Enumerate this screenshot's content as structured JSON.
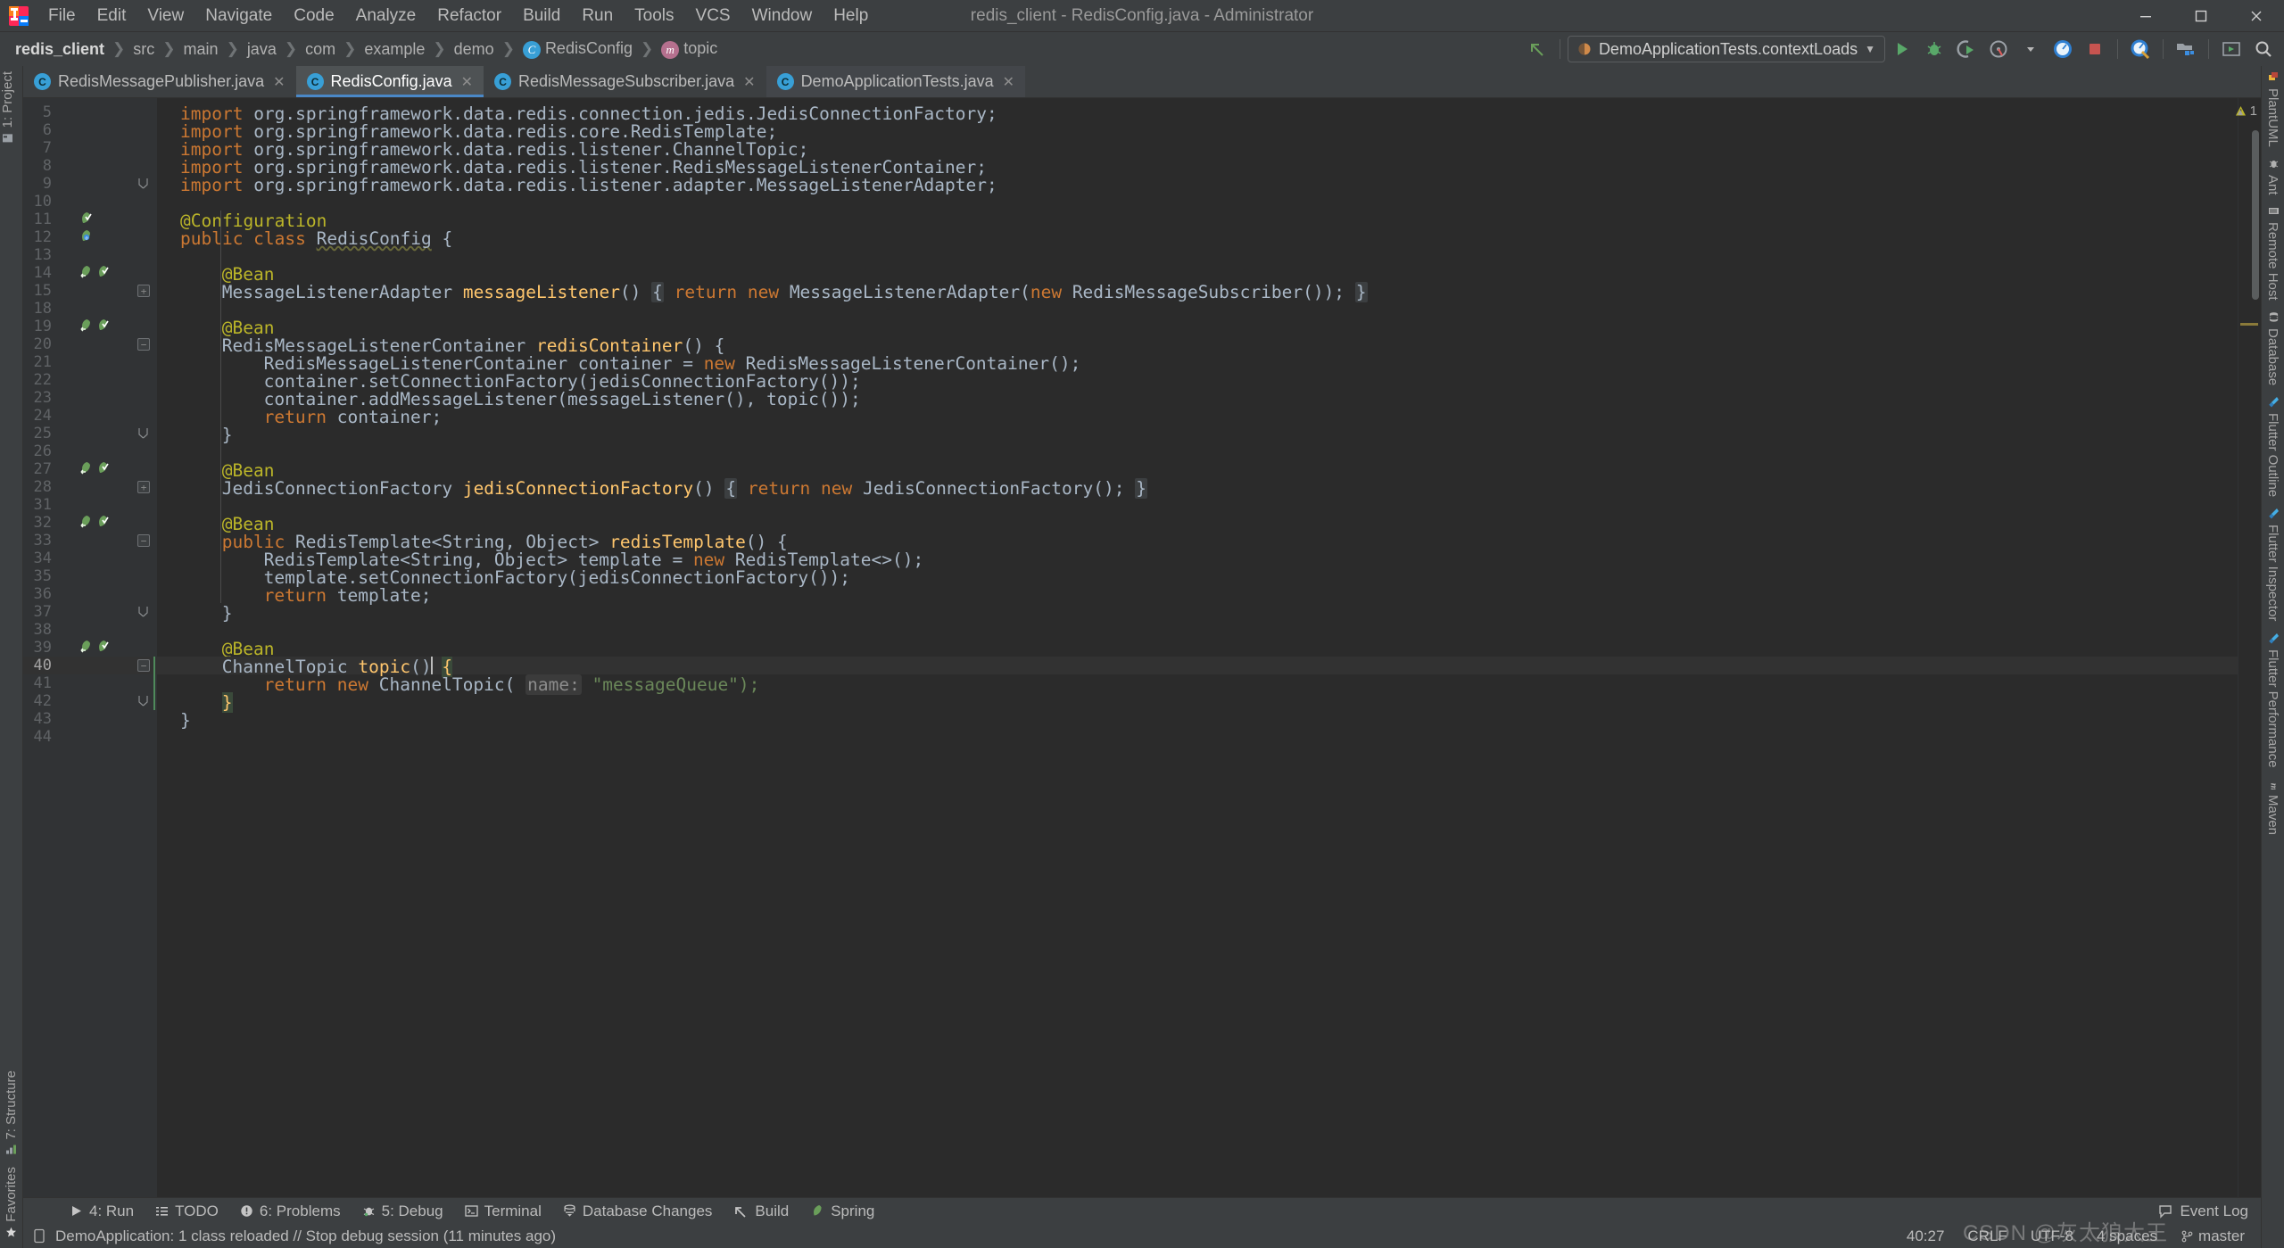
{
  "window": {
    "title": "redis_client - RedisConfig.java - Administrator",
    "minimize": "—",
    "maximize": "☐",
    "close": "✕"
  },
  "menu": {
    "items": [
      "File",
      "Edit",
      "View",
      "Navigate",
      "Code",
      "Analyze",
      "Refactor",
      "Build",
      "Run",
      "Tools",
      "VCS",
      "Window",
      "Help"
    ]
  },
  "breadcrumbs": [
    {
      "label": "redis_client",
      "bold": true,
      "icon": null
    },
    {
      "label": "src",
      "bold": false,
      "icon": null
    },
    {
      "label": "main",
      "bold": false,
      "icon": null
    },
    {
      "label": "java",
      "bold": false,
      "icon": null
    },
    {
      "label": "com",
      "bold": false,
      "icon": null
    },
    {
      "label": "example",
      "bold": false,
      "icon": null
    },
    {
      "label": "demo",
      "bold": false,
      "icon": null
    },
    {
      "label": "RedisConfig",
      "bold": false,
      "icon": "C",
      "iconColor": "#389fd6"
    },
    {
      "label": "topic",
      "bold": false,
      "icon": "m",
      "iconColor": "#b5708e"
    }
  ],
  "toolbar": {
    "run_config": "DemoApplicationTests.contextLoads",
    "dropdown_arrow": "▼",
    "icons": [
      "back-arrow-icon",
      "run-icon",
      "debug-icon",
      "run-coverage-icon",
      "profiler-icon",
      "stop-icon",
      "attach-profiler-icon",
      "project-structure-icon",
      "update-running-app-icon",
      "search-everywhere-icon"
    ]
  },
  "tabs": [
    {
      "label": "RedisMessagePublisher.java",
      "active": false,
      "dim": false,
      "icon": "C",
      "iconColor": "#389fd6"
    },
    {
      "label": "RedisConfig.java",
      "active": true,
      "dim": false,
      "icon": "C",
      "iconColor": "#389fd6"
    },
    {
      "label": "RedisMessageSubscriber.java",
      "active": false,
      "dim": false,
      "icon": "C",
      "iconColor": "#389fd6"
    },
    {
      "label": "DemoApplicationTests.java",
      "active": false,
      "dim": true,
      "icon": "C",
      "iconColor": "#389fd6"
    }
  ],
  "editor": {
    "first_line": 5,
    "inspection_count": "1",
    "inspection_icon": "warning-triangle-icon",
    "lines": [
      {
        "n": 5,
        "indent": 0,
        "tokens": [
          {
            "t": "import ",
            "c": "kw"
          },
          {
            "t": "org.springframework.data.redis.connection.jedis.JedisConnectionFactory;",
            "c": "cls"
          }
        ]
      },
      {
        "n": 6,
        "indent": 0,
        "tokens": [
          {
            "t": "import ",
            "c": "kw"
          },
          {
            "t": "org.springframework.data.redis.core.RedisTemplate;",
            "c": "cls"
          }
        ]
      },
      {
        "n": 7,
        "indent": 0,
        "tokens": [
          {
            "t": "import ",
            "c": "kw"
          },
          {
            "t": "org.springframework.data.redis.listener.ChannelTopic;",
            "c": "cls"
          }
        ]
      },
      {
        "n": 8,
        "indent": 0,
        "tokens": [
          {
            "t": "import ",
            "c": "kw"
          },
          {
            "t": "org.springframework.data.redis.listener.RedisMessageListenerContainer;",
            "c": "cls"
          }
        ]
      },
      {
        "n": 9,
        "indent": 0,
        "tokens": [
          {
            "t": "import ",
            "c": "kw"
          },
          {
            "t": "org.springframework.data.redis.listener.adapter.MessageListenerAdapter;",
            "c": "cls"
          }
        ]
      },
      {
        "n": 10,
        "indent": 0,
        "tokens": []
      },
      {
        "n": 11,
        "indent": 0,
        "tokens": [
          {
            "t": "@Configuration",
            "c": "ann"
          }
        ]
      },
      {
        "n": 12,
        "indent": 0,
        "tokens": [
          {
            "t": "public class ",
            "c": "kw"
          },
          {
            "t": "RedisConfig",
            "c": "squiggle"
          },
          {
            "t": " {",
            "c": "cls"
          }
        ]
      },
      {
        "n": 13,
        "indent": 0,
        "tokens": []
      },
      {
        "n": 14,
        "indent": 1,
        "tokens": [
          {
            "t": "@Bean",
            "c": "ann"
          }
        ]
      },
      {
        "n": 15,
        "indent": 1,
        "tokens": [
          {
            "t": "MessageListenerAdapter ",
            "c": "cls"
          },
          {
            "t": "messageListener",
            "c": "mth"
          },
          {
            "t": "() ",
            "c": "cls"
          },
          {
            "t": "{",
            "c": "fold-brace"
          },
          {
            "t": " ",
            "c": "cls"
          },
          {
            "t": "return new ",
            "c": "kw"
          },
          {
            "t": "MessageListenerAdapter(",
            "c": "cls"
          },
          {
            "t": "new ",
            "c": "kw"
          },
          {
            "t": "RedisMessageSubscriber()); ",
            "c": "cls"
          },
          {
            "t": "}",
            "c": "fold-brace"
          }
        ]
      },
      {
        "n": 18,
        "indent": 0,
        "tokens": []
      },
      {
        "n": 19,
        "indent": 1,
        "tokens": [
          {
            "t": "@Bean",
            "c": "ann"
          }
        ]
      },
      {
        "n": 20,
        "indent": 1,
        "tokens": [
          {
            "t": "RedisMessageListenerContainer ",
            "c": "cls"
          },
          {
            "t": "redisContainer",
            "c": "mth"
          },
          {
            "t": "() {",
            "c": "cls"
          }
        ]
      },
      {
        "n": 21,
        "indent": 2,
        "tokens": [
          {
            "t": "RedisMessageListenerContainer container = ",
            "c": "cls"
          },
          {
            "t": "new ",
            "c": "kw"
          },
          {
            "t": "RedisMessageListenerContainer();",
            "c": "cls"
          }
        ]
      },
      {
        "n": 22,
        "indent": 2,
        "tokens": [
          {
            "t": "container.setConnectionFactory(jedisConnectionFactory());",
            "c": "cls"
          }
        ]
      },
      {
        "n": 23,
        "indent": 2,
        "tokens": [
          {
            "t": "container.addMessageListener(messageListener(), topic());",
            "c": "cls"
          }
        ]
      },
      {
        "n": 24,
        "indent": 2,
        "tokens": [
          {
            "t": "return ",
            "c": "kw"
          },
          {
            "t": "container;",
            "c": "cls"
          }
        ]
      },
      {
        "n": 25,
        "indent": 1,
        "tokens": [
          {
            "t": "}",
            "c": "cls"
          }
        ]
      },
      {
        "n": 26,
        "indent": 0,
        "tokens": []
      },
      {
        "n": 27,
        "indent": 1,
        "tokens": [
          {
            "t": "@Bean",
            "c": "ann"
          }
        ]
      },
      {
        "n": 28,
        "indent": 1,
        "tokens": [
          {
            "t": "JedisConnectionFactory ",
            "c": "cls"
          },
          {
            "t": "jedisConnectionFactory",
            "c": "mth"
          },
          {
            "t": "() ",
            "c": "cls"
          },
          {
            "t": "{",
            "c": "fold-brace"
          },
          {
            "t": " ",
            "c": "cls"
          },
          {
            "t": "return new ",
            "c": "kw"
          },
          {
            "t": "JedisConnectionFactory(); ",
            "c": "cls"
          },
          {
            "t": "}",
            "c": "fold-brace"
          }
        ]
      },
      {
        "n": 31,
        "indent": 0,
        "tokens": []
      },
      {
        "n": 32,
        "indent": 1,
        "tokens": [
          {
            "t": "@Bean",
            "c": "ann"
          }
        ]
      },
      {
        "n": 33,
        "indent": 1,
        "tokens": [
          {
            "t": "public ",
            "c": "kw"
          },
          {
            "t": "RedisTemplate<String, Object> ",
            "c": "cls"
          },
          {
            "t": "redisTemplate",
            "c": "mth"
          },
          {
            "t": "() {",
            "c": "cls"
          }
        ]
      },
      {
        "n": 34,
        "indent": 2,
        "tokens": [
          {
            "t": "RedisTemplate<String, Object> template = ",
            "c": "cls"
          },
          {
            "t": "new ",
            "c": "kw"
          },
          {
            "t": "RedisTemplate<>();",
            "c": "cls"
          }
        ]
      },
      {
        "n": 35,
        "indent": 2,
        "tokens": [
          {
            "t": "template.setConnectionFactory(jedisConnectionFactory());",
            "c": "cls"
          }
        ]
      },
      {
        "n": 36,
        "indent": 2,
        "tokens": [
          {
            "t": "return ",
            "c": "kw"
          },
          {
            "t": "template;",
            "c": "cls"
          }
        ]
      },
      {
        "n": 37,
        "indent": 1,
        "tokens": [
          {
            "t": "}",
            "c": "cls"
          }
        ]
      },
      {
        "n": 38,
        "indent": 0,
        "tokens": []
      },
      {
        "n": 39,
        "indent": 1,
        "tokens": [
          {
            "t": "@Bean",
            "c": "ann"
          }
        ]
      },
      {
        "n": 40,
        "indent": 1,
        "current": true,
        "tokens": [
          {
            "t": "ChannelTopic ",
            "c": "cls"
          },
          {
            "t": "topic",
            "c": "mth"
          },
          {
            "t": "() ",
            "c": "cls"
          },
          {
            "t": "{",
            "c": "brace-hl"
          }
        ]
      },
      {
        "n": 41,
        "indent": 2,
        "tokens": [
          {
            "t": "return new ",
            "c": "kw"
          },
          {
            "t": "ChannelTopic( ",
            "c": "cls"
          },
          {
            "t": "name:",
            "c": "hint"
          },
          {
            "t": " ",
            "c": "cls"
          },
          {
            "t": "\"messageQueue\");",
            "c": "str"
          }
        ]
      },
      {
        "n": 42,
        "indent": 1,
        "tokens": [
          {
            "t": "}",
            "c": "brace-hl"
          }
        ]
      },
      {
        "n": 43,
        "indent": 0,
        "tokens": [
          {
            "t": "}",
            "c": "cls"
          }
        ]
      },
      {
        "n": 44,
        "indent": 0,
        "tokens": []
      }
    ]
  },
  "left_strip": [
    {
      "label": "1: Project",
      "icon": "project-icon"
    },
    {
      "label": "7: Structure",
      "icon": "structure-icon"
    },
    {
      "label": "Favorites",
      "icon": "star-icon"
    }
  ],
  "right_strip": [
    {
      "label": "PlantUML",
      "icon": "plantuml-icon"
    },
    {
      "label": "Ant",
      "icon": "ant-icon"
    },
    {
      "label": "Remote Host",
      "icon": "remote-host-icon"
    },
    {
      "label": "Database",
      "icon": "database-icon"
    },
    {
      "label": "Flutter Outline",
      "icon": "flutter-icon"
    },
    {
      "label": "Flutter Inspector",
      "icon": "flutter-icon"
    },
    {
      "label": "Flutter Performance",
      "icon": "flutter-icon"
    },
    {
      "label": "Maven",
      "icon": "maven-icon"
    }
  ],
  "tool_window_bar": {
    "items": [
      {
        "label": "4: Run",
        "icon": "run-icon"
      },
      {
        "label": "TODO",
        "icon": "todo-icon"
      },
      {
        "label": "6: Problems",
        "icon": "problems-icon"
      },
      {
        "label": "5: Debug",
        "icon": "debug-icon"
      },
      {
        "label": "Terminal",
        "icon": "terminal-icon"
      },
      {
        "label": "Database Changes",
        "icon": "database-changes-icon"
      },
      {
        "label": "Build",
        "icon": "build-icon"
      },
      {
        "label": "Spring",
        "icon": "spring-icon"
      }
    ],
    "event_log": "Event Log"
  },
  "status": {
    "message": "DemoApplication: 1 class reloaded // Stop debug session (11 minutes ago)",
    "caret": "40:27",
    "line_sep": "CRLF",
    "encoding": "UTF-8",
    "indent": "4 spaces",
    "branch": "master",
    "watermark": "CSDN @灰太狼大王"
  },
  "colors": {
    "accent": "#4a88c7",
    "bg": "#3c3f41",
    "editor_bg": "#2b2b2b",
    "gutter_bg": "#313335",
    "keyword": "#cc7832",
    "string": "#6a8759",
    "annotation": "#bbb529",
    "method": "#ffc66d",
    "text": "#a9b7c6"
  }
}
